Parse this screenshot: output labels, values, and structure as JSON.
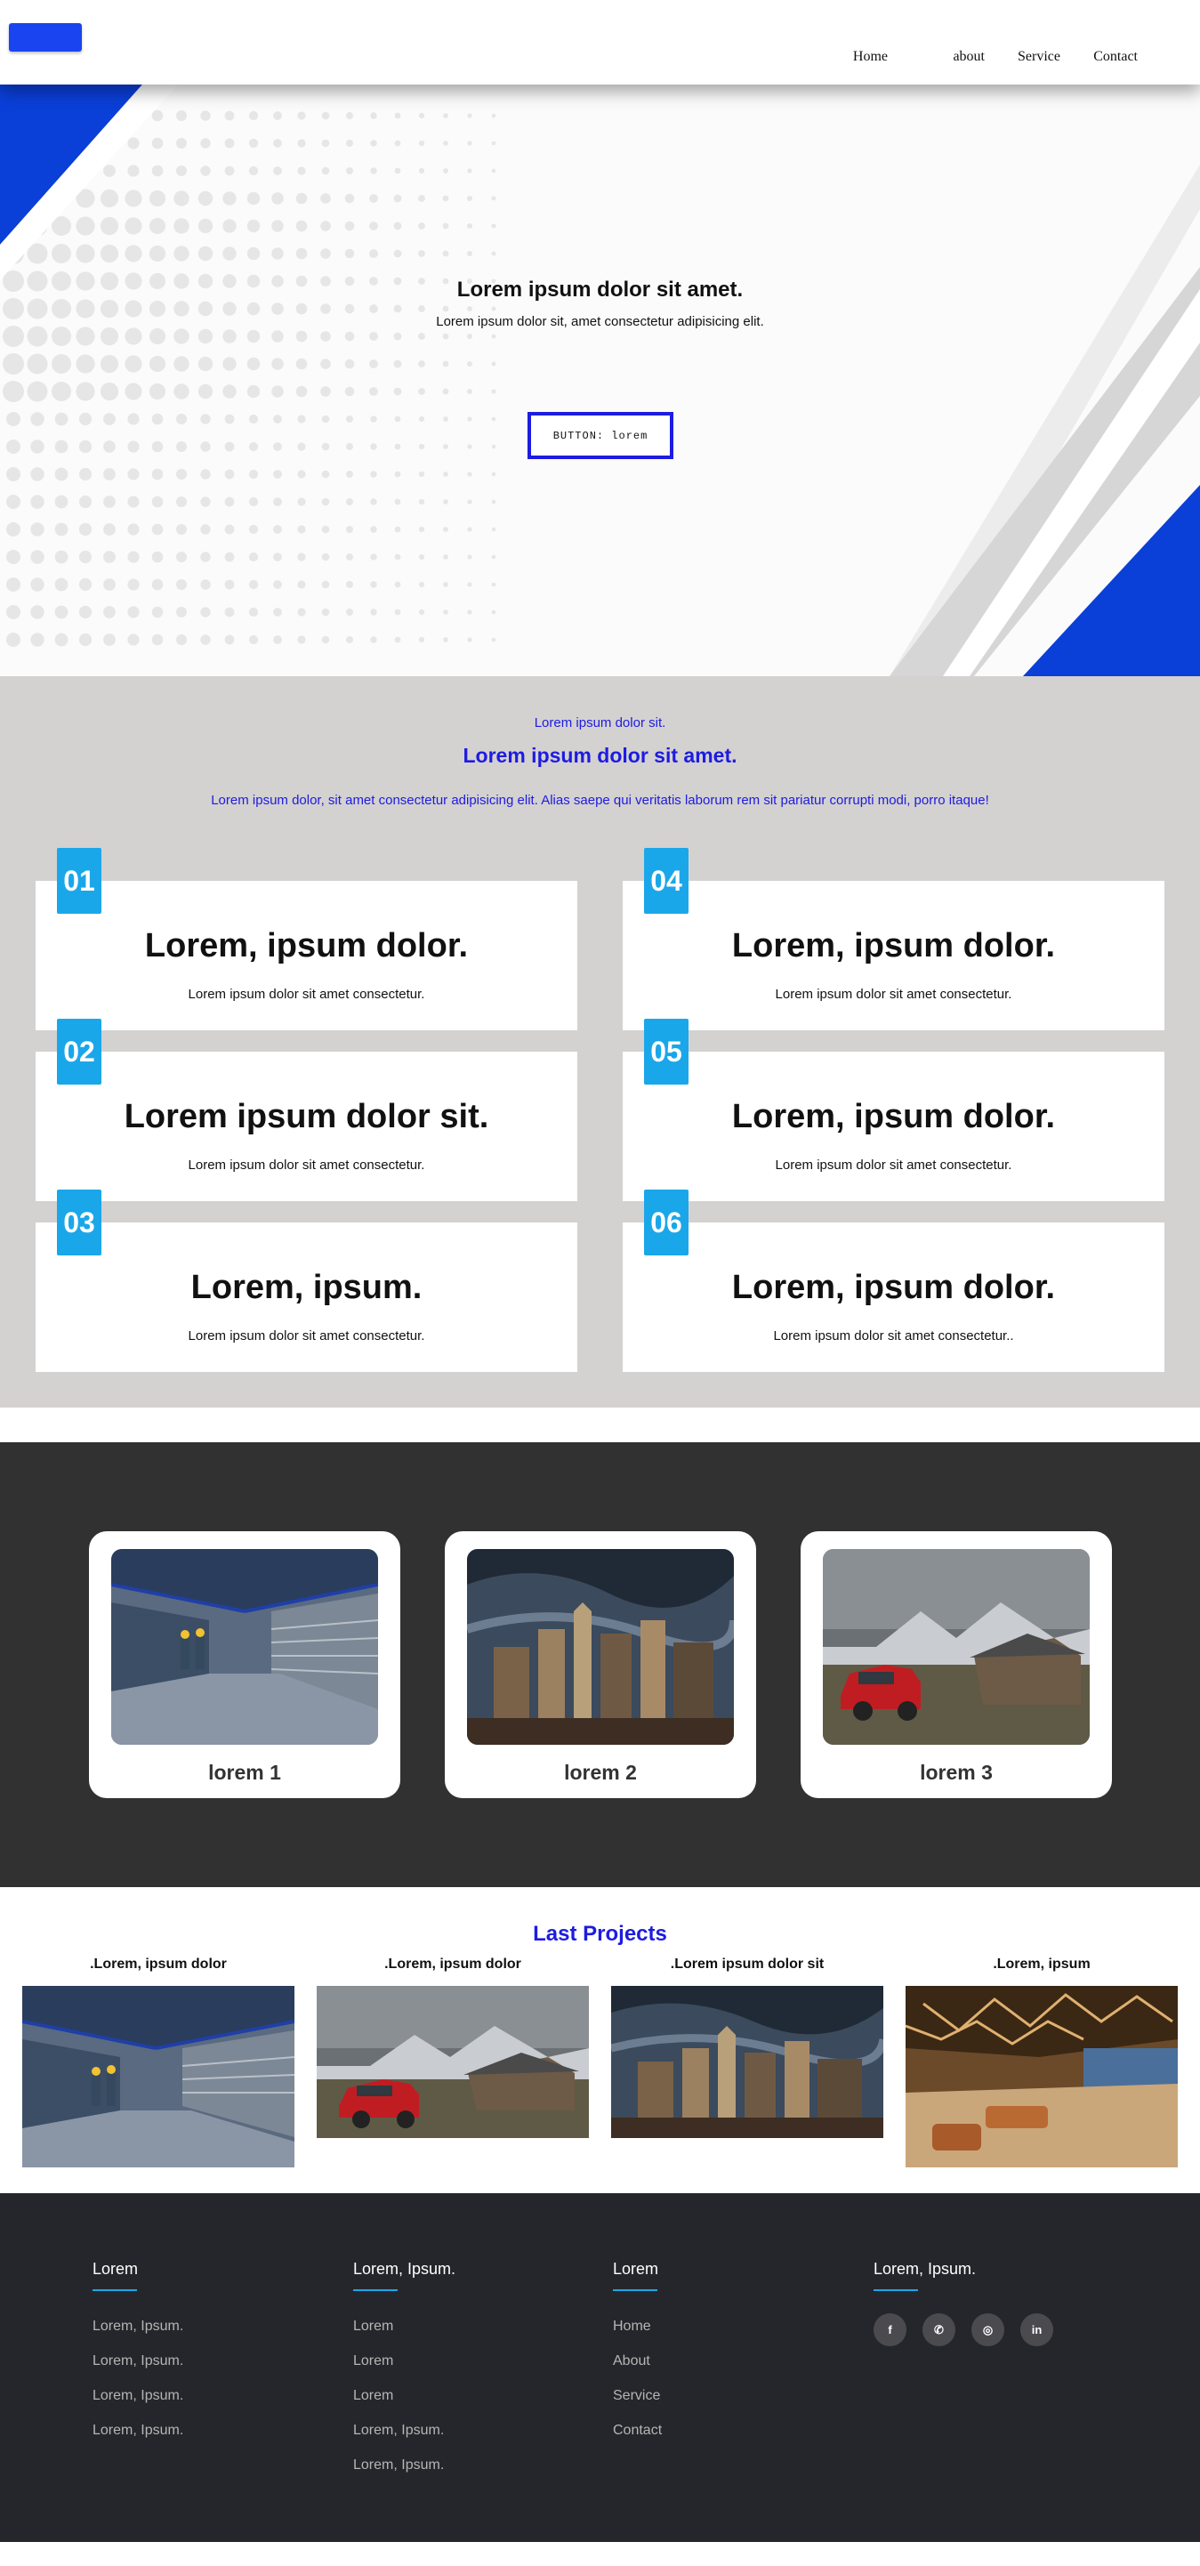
{
  "nav": {
    "items": [
      "Home",
      "about",
      "Service",
      "Contact"
    ]
  },
  "hero": {
    "title": "Lorem ipsum dolor sit amet.",
    "subtitle": "Lorem ipsum dolor sit, amet consectetur adipisicing elit.",
    "button_label": "BUTTON: lorem"
  },
  "features": {
    "kicker": "Lorem ipsum dolor sit.",
    "title": "Lorem ipsum dolor sit amet.",
    "description": "Lorem ipsum dolor, sit amet consectetur adipisicing elit. Alias saepe qui veritatis laborum rem sit pariatur corrupti modi, porro itaque!",
    "cards": [
      {
        "num": "01",
        "title": "Lorem, ipsum dolor.",
        "text": "Lorem ipsum dolor sit amet consectetur."
      },
      {
        "num": "02",
        "title": "Lorem ipsum dolor sit.",
        "text": "Lorem ipsum dolor sit amet consectetur."
      },
      {
        "num": "03",
        "title": "Lorem, ipsum.",
        "text": "Lorem ipsum dolor sit amet consectetur."
      },
      {
        "num": "04",
        "title": "Lorem, ipsum dolor.",
        "text": "Lorem ipsum dolor sit amet consectetur."
      },
      {
        "num": "05",
        "title": "Lorem, ipsum dolor.",
        "text": "Lorem ipsum dolor sit amet consectetur."
      },
      {
        "num": "06",
        "title": "Lorem, ipsum dolor.",
        "text": "Lorem ipsum dolor sit amet consectetur.."
      }
    ]
  },
  "gallery": {
    "cards": [
      {
        "caption": "lorem 1",
        "image": "warehouse-workers-photo"
      },
      {
        "caption": "lorem 2",
        "image": "city-skyline-photo"
      },
      {
        "caption": "lorem 3",
        "image": "red-car-mountains-photo"
      }
    ]
  },
  "projects": {
    "title": "Last Projects",
    "items": [
      {
        "caption": ".Lorem, ipsum dolor",
        "image": "warehouse-workers-photo"
      },
      {
        "caption": ".Lorem, ipsum dolor",
        "image": "red-car-mountains-photo"
      },
      {
        "caption": ".Lorem ipsum dolor sit",
        "image": "city-skyline-photo"
      },
      {
        "caption": ".Lorem, ipsum",
        "image": "modern-interior-photo"
      }
    ]
  },
  "footer": {
    "columns": [
      {
        "title": "Lorem",
        "links": [
          "Lorem, Ipsum.",
          "Lorem, Ipsum.",
          "Lorem, Ipsum.",
          "Lorem, Ipsum."
        ]
      },
      {
        "title": "Lorem, Ipsum.",
        "links": [
          "Lorem",
          "Lorem",
          "Lorem",
          "Lorem, Ipsum.",
          "Lorem, Ipsum."
        ]
      },
      {
        "title": "Lorem",
        "links": [
          "Home",
          "About",
          "Service",
          "Contact"
        ]
      },
      {
        "title": "Lorem, Ipsum.",
        "links": []
      }
    ],
    "socials": [
      {
        "icon": "facebook-icon",
        "glyph": "f"
      },
      {
        "icon": "whatsapp-icon",
        "glyph": "✆"
      },
      {
        "icon": "instagram-icon",
        "glyph": "◎"
      },
      {
        "icon": "linkedin-icon",
        "glyph": "in"
      }
    ]
  },
  "colors": {
    "brand_blue": "#1d1ce0",
    "accent_cyan": "#1aa7ea",
    "gray_section": "#d4d1d1",
    "dark_section": "#313131",
    "footer_bg": "#25262b"
  }
}
